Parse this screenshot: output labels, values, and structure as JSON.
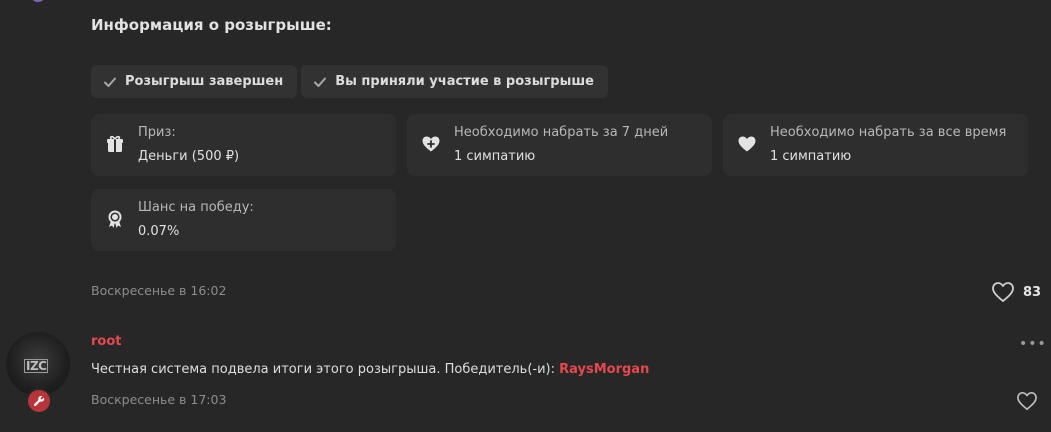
{
  "section": {
    "title": "Информация о розыгрыше:"
  },
  "badges": [
    {
      "label": "Розыгрыш завершен"
    },
    {
      "label": "Вы приняли участие в розыгрыше"
    }
  ],
  "cards": {
    "prize": {
      "key": "Приз:",
      "value": "Деньги (500 ₽)",
      "icon": "gift-icon"
    },
    "week": {
      "key": "Необходимо набрать за 7 дней",
      "value": "1 симпатию",
      "icon": "heart-plus-icon"
    },
    "alltime": {
      "key": "Необходимо набрать за все время",
      "value": "1 симпатию",
      "icon": "heart-icon"
    },
    "chance": {
      "key": "Шанс на победу:",
      "value": "0.07%",
      "icon": "award-icon"
    }
  },
  "post1": {
    "time": "Воскресенье в 16:02",
    "likes": "83"
  },
  "post2": {
    "username": "root",
    "avatar_text": "IZC",
    "message_prefix": "Честная система подвела итоги этого розыгрыша. Победитель(-и): ",
    "winner": "RaysMorgan",
    "time": "Воскресенье в 17:03"
  },
  "colors": {
    "background": "#272727",
    "card": "#2e2e2e",
    "accent_red": "#e5484d",
    "badge_red": "#b7353a"
  }
}
